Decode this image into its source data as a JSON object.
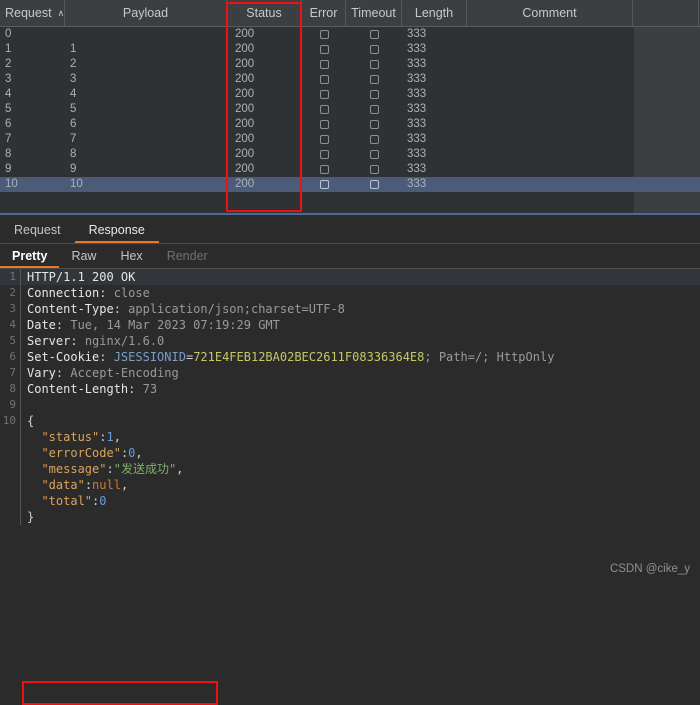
{
  "results_table": {
    "columns": [
      {
        "key": "request",
        "label": "Request",
        "sort_indicator": "∧"
      },
      {
        "key": "payload",
        "label": "Payload",
        "sort_indicator": ""
      },
      {
        "key": "status",
        "label": "Status",
        "sort_indicator": ""
      },
      {
        "key": "error",
        "label": "Error",
        "sort_indicator": ""
      },
      {
        "key": "timeout",
        "label": "Timeout",
        "sort_indicator": ""
      },
      {
        "key": "length",
        "label": "Length",
        "sort_indicator": ""
      },
      {
        "key": "comment",
        "label": "Comment",
        "sort_indicator": ""
      }
    ],
    "rows": [
      {
        "request": "0",
        "payload": "",
        "status": "200",
        "error": false,
        "timeout": false,
        "length": "333",
        "comment": "",
        "selected": false
      },
      {
        "request": "1",
        "payload": "1",
        "status": "200",
        "error": false,
        "timeout": false,
        "length": "333",
        "comment": "",
        "selected": false
      },
      {
        "request": "2",
        "payload": "2",
        "status": "200",
        "error": false,
        "timeout": false,
        "length": "333",
        "comment": "",
        "selected": false
      },
      {
        "request": "3",
        "payload": "3",
        "status": "200",
        "error": false,
        "timeout": false,
        "length": "333",
        "comment": "",
        "selected": false
      },
      {
        "request": "4",
        "payload": "4",
        "status": "200",
        "error": false,
        "timeout": false,
        "length": "333",
        "comment": "",
        "selected": false
      },
      {
        "request": "5",
        "payload": "5",
        "status": "200",
        "error": false,
        "timeout": false,
        "length": "333",
        "comment": "",
        "selected": false
      },
      {
        "request": "6",
        "payload": "6",
        "status": "200",
        "error": false,
        "timeout": false,
        "length": "333",
        "comment": "",
        "selected": false
      },
      {
        "request": "7",
        "payload": "7",
        "status": "200",
        "error": false,
        "timeout": false,
        "length": "333",
        "comment": "",
        "selected": false
      },
      {
        "request": "8",
        "payload": "8",
        "status": "200",
        "error": false,
        "timeout": false,
        "length": "333",
        "comment": "",
        "selected": false
      },
      {
        "request": "9",
        "payload": "9",
        "status": "200",
        "error": false,
        "timeout": false,
        "length": "333",
        "comment": "",
        "selected": false
      },
      {
        "request": "10",
        "payload": "10",
        "status": "200",
        "error": false,
        "timeout": false,
        "length": "333",
        "comment": "",
        "selected": true
      }
    ]
  },
  "detail": {
    "message_tabs": [
      {
        "label": "Request",
        "active": false
      },
      {
        "label": "Response",
        "active": true
      }
    ],
    "view_tabs": [
      {
        "label": "Pretty",
        "active": true,
        "disabled": false
      },
      {
        "label": "Raw",
        "active": false,
        "disabled": false
      },
      {
        "label": "Hex",
        "active": false,
        "disabled": false
      },
      {
        "label": "Render",
        "active": false,
        "disabled": true
      }
    ],
    "response_lines": [
      {
        "n": "1",
        "text": "HTTP/1.1 200 OK"
      },
      {
        "n": "2",
        "text": "Connection: close"
      },
      {
        "n": "3",
        "text": "Content-Type: application/json;charset=UTF-8"
      },
      {
        "n": "4",
        "text": "Date: Tue, 14 Mar 2023 07:19:29 GMT"
      },
      {
        "n": "5",
        "text": "Server: nginx/1.6.0"
      },
      {
        "n": "6",
        "text": "Set-Cookie: JSESSIONID=721E4FEB12BA02BEC2611F08336364E8; Path=/; HttpOnly"
      },
      {
        "n": "7",
        "text": "Vary: Accept-Encoding"
      },
      {
        "n": "8",
        "text": "Content-Length: 73"
      },
      {
        "n": "9",
        "text": ""
      },
      {
        "n": "10",
        "text": "{"
      },
      {
        "n": "",
        "text": "  \"status\":1,"
      },
      {
        "n": "",
        "text": "  \"errorCode\":0,"
      },
      {
        "n": "",
        "text": "  \"message\":\"发送成功\","
      },
      {
        "n": "",
        "text": "  \"data\":null,"
      },
      {
        "n": "",
        "text": "  \"total\":0"
      },
      {
        "n": "",
        "text": "}"
      }
    ],
    "status_line": {
      "protocol": "HTTP/1.1",
      "code": "200",
      "reason": "OK"
    },
    "headers": [
      {
        "name": "Connection",
        "value": "close"
      },
      {
        "name": "Content-Type",
        "value": "application/json;charset=UTF-8"
      },
      {
        "name": "Date",
        "value": "Tue, 14 Mar 2023 07:19:29 GMT"
      },
      {
        "name": "Server",
        "value": "nginx/1.6.0"
      },
      {
        "name": "Vary",
        "value": "Accept-Encoding"
      },
      {
        "name": "Content-Length",
        "value": "73"
      }
    ],
    "set_cookie": {
      "label": "Set-Cookie",
      "cookie_name": "JSESSIONID",
      "cookie_value": "721E4FEB12BA02BEC2611F08336364E8",
      "attributes": "; Path=/; HttpOnly"
    },
    "json_body": {
      "status": "1",
      "errorCode": "0",
      "message": "发送成功",
      "data": "null",
      "total": "0"
    },
    "line_numbers": [
      "1",
      "2",
      "3",
      "4",
      "5",
      "6",
      "7",
      "8",
      "9",
      "10"
    ]
  },
  "annotations": {
    "status_column_box_color": "#ee1111",
    "message_line_box_color": "#ee1111"
  },
  "watermark": {
    "text": "CSDN @cike_y"
  },
  "colors": {
    "accent": "#e8772a",
    "selection": "#4b5b78",
    "background": "#2b2b2b",
    "header_background": "#3c3f41",
    "annotation_red": "#ee1111"
  }
}
